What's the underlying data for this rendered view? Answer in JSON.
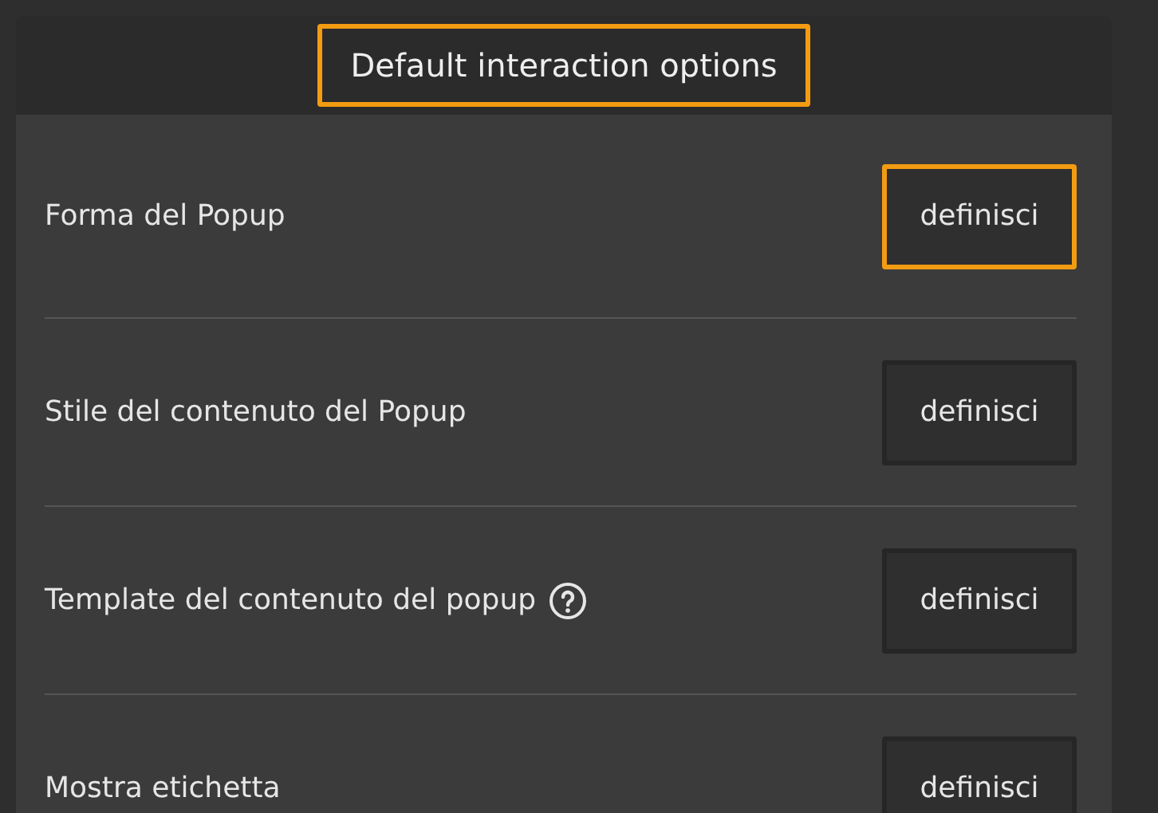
{
  "panel": {
    "title": "Default interaction options",
    "title_highlighted": true
  },
  "options": [
    {
      "label": "Forma del Popup",
      "help": false,
      "button": "definisci",
      "highlighted": true
    },
    {
      "label": "Stile del contenuto del Popup",
      "help": false,
      "button": "definisci",
      "highlighted": false
    },
    {
      "label": "Template del contenuto del popup",
      "help": true,
      "button": "definisci",
      "highlighted": false
    },
    {
      "label": "Mostra etichetta",
      "help": false,
      "button": "definisci",
      "highlighted": false
    }
  ]
}
